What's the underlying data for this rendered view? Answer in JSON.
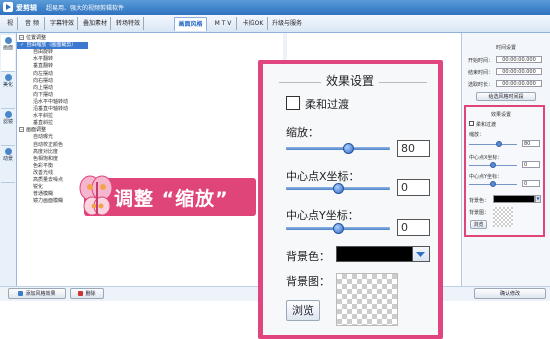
{
  "app": {
    "title": "爱剪辑",
    "subtitle": "超易用、强大的视频剪辑软件"
  },
  "tabs": [
    "视",
    "音 频",
    "字幕特效",
    "叠加素材",
    "转场特效",
    "画面风格",
    "M T V",
    "卡拉OK",
    "升级与服务"
  ],
  "active_tab": "画面风格",
  "side_tabs": [
    "画面",
    "美化",
    "滤镜",
    "动景"
  ],
  "style_list": {
    "groups": [
      {
        "label": "位置调整",
        "items": [
          "自由缩放（画面裁剪）",
          "自由旋转",
          "水平翻转",
          "垂直翻转",
          "向左摆动",
          "向右摆动",
          "向上摆动",
          "向下摆动",
          "沿水平中轴转动",
          "沿垂直中轴转动",
          "水平斜拉",
          "垂直斜拉"
        ]
      },
      {
        "label": "画面调整",
        "items": [
          "自动曝光",
          "自动校正颜色",
          "高度对比度",
          "色相饱和度",
          "色彩平衡",
          "改善光线",
          "高质量去噪点",
          "锐化",
          "普通模糊",
          "镜力画面模糊"
        ]
      }
    ],
    "selected": "自由缩放（画面裁剪）"
  },
  "bottom": {
    "add_style": "添加风格效果",
    "remove": "删除",
    "confirm": "确认修改"
  },
  "time_settings": {
    "title": "时间设置",
    "start_label": "开始时间：",
    "start_value": "00:00:00.000",
    "end_label": "结束时间：",
    "end_value": "00:00:00.000",
    "duration_label": "选取时长：",
    "duration_value": "00:00:00.000",
    "button": "给选风格时间段"
  },
  "small_effect": {
    "title": "效果设置",
    "smooth_label": "柔和过渡",
    "scale_label": "缩放：",
    "scale_value": "80",
    "cx_label": "中心点X坐标：",
    "cx_value": "0",
    "cy_label": "中心点Y坐标：",
    "cy_value": "0",
    "bgcolor_label": "背景色：",
    "bgimage_label": "背景图：",
    "browse": "浏览"
  },
  "effect": {
    "title": "效果设置",
    "smooth_label": "柔和过渡",
    "scale_label": "缩放：",
    "scale_value": "80",
    "scale_level": 0.6,
    "cx_label": "中心点X坐标：",
    "cx_value": "0",
    "cx_level": 0.5,
    "cy_label": "中心点Y坐标：",
    "cy_value": "0",
    "cy_level": 0.5,
    "bgcolor_label": "背景色：",
    "bgcolor": "#000000",
    "bgimage_label": "背景图：",
    "browse": "浏览"
  },
  "callout": {
    "text": "调整 “缩放”"
  },
  "colors": {
    "accent": "#e0457a",
    "title_bar": "#2f72bf",
    "selection": "#3a79cf"
  }
}
